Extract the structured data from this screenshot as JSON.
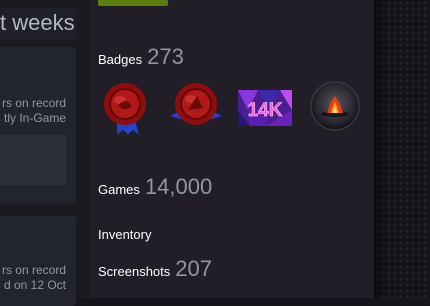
{
  "left": {
    "heading_partial": "t weeks",
    "card1": {
      "line1": "rs on record",
      "line2": "tly In-Game"
    },
    "card2": {
      "line1": "rs on record",
      "line2": "d on 12 Oct"
    }
  },
  "profile": {
    "level_badge_text": "",
    "badges": {
      "label": "Badges",
      "count": "273"
    },
    "badge_icons": [
      {
        "icon": "red-wax-seal-ribbon-badge-icon"
      },
      {
        "icon": "red-wax-seal-winged-badge-icon"
      },
      {
        "icon": "14k-badge-icon",
        "text": "14K"
      },
      {
        "icon": "campfire-orb-badge-icon"
      }
    ],
    "games": {
      "label": "Games",
      "count": "14,000"
    },
    "inventory": {
      "label": "Inventory"
    },
    "screenshots": {
      "label": "Screenshots",
      "count": "207"
    }
  },
  "colors": {
    "page_bg": "#17141c",
    "panel_bg": "#221e27",
    "label_white": "#ffffff",
    "count_grey": "#8f98a0",
    "level_green": "#5c7e10"
  }
}
